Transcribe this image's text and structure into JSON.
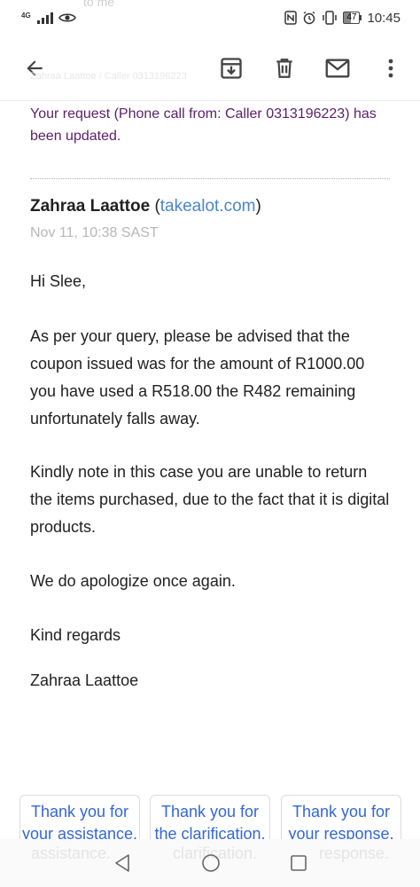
{
  "status": {
    "network": "4G",
    "battery": "47",
    "time": "10:45"
  },
  "background": {
    "top_ghost": "to me",
    "sub_ghost": "Zahraa Laattoe / Caller 0313196223"
  },
  "toolbar": {
    "back_icon": "arrow-back-icon",
    "archive_icon": "archive-icon",
    "delete_icon": "delete-icon",
    "mark_unread_icon": "mail-icon",
    "more_icon": "more-vert-icon"
  },
  "email": {
    "notice": "Your request (Phone call from: Caller 0313196223) has been updated.",
    "sender_name": "Zahraa Laattoe",
    "open_paren": "(",
    "sender_domain": "takealot.com",
    "close_paren": ")",
    "timestamp": "Nov 11, 10:38 SAST",
    "greeting": "Hi Slee,",
    "paragraph1": "As per your query, please be advised that the coupon issued was for the amount of R1000.00 you have used a R518.00 the R482 remaining unfortunately falls away.",
    "paragraph2": "Kindly note in this case you are unable to return the items purchased, due to the fact that it is digital products.",
    "paragraph3": "We do apologize once again.",
    "closing": "Kind regards",
    "signature": "Zahraa Laattoe"
  },
  "smart_replies": [
    {
      "label": "Thank you for your assistance."
    },
    {
      "label": "Thank you for the clarification."
    },
    {
      "label": "Thank you for your response."
    }
  ],
  "nav_ghost": {
    "left": "assistance.",
    "middle": "clarification.",
    "right": "response."
  },
  "colors": {
    "notice": "#5c1d6b",
    "link": "#4a86c8",
    "chip_text": "#3367d6"
  }
}
